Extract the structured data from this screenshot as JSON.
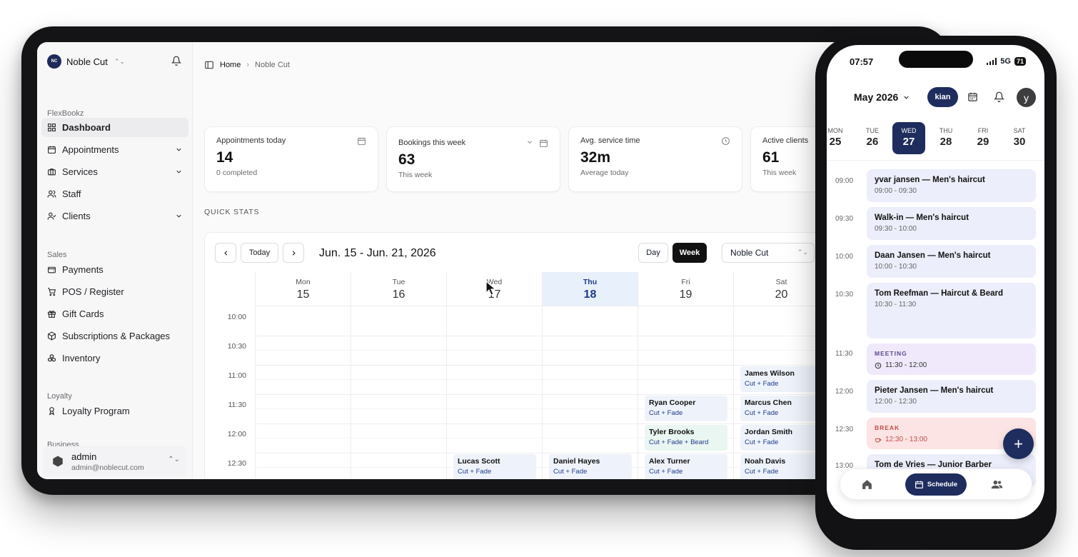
{
  "sidebar": {
    "org_initials": "NC",
    "org_name": "Noble Cut",
    "section_main": "FlexBookz",
    "section_sales": "Sales",
    "section_loyalty": "Loyalty",
    "section_business": "Business",
    "items": [
      {
        "label": "Dashboard",
        "icon": "dashboard-icon"
      },
      {
        "label": "Appointments",
        "icon": "calendar-icon"
      },
      {
        "label": "Services",
        "icon": "briefcase-icon"
      },
      {
        "label": "Staff",
        "icon": "users-icon"
      },
      {
        "label": "Clients",
        "icon": "user-check-icon"
      },
      {
        "label": "Payments",
        "icon": "wallet-icon"
      },
      {
        "label": "POS / Register",
        "icon": "cart-icon"
      },
      {
        "label": "Gift Cards",
        "icon": "gift-icon"
      },
      {
        "label": "Subscriptions & Packages",
        "icon": "package-icon"
      },
      {
        "label": "Inventory",
        "icon": "boxes-icon"
      },
      {
        "label": "Loyalty Program",
        "icon": "award-icon"
      }
    ],
    "user_name": "admin",
    "user_email": "admin@noblecut.com"
  },
  "breadcrumb": {
    "home": "Home",
    "current": "Noble Cut"
  },
  "cards": [
    {
      "label": "Appointments today",
      "value": "14",
      "sub": "0 completed"
    },
    {
      "label": "Bookings this week",
      "value": "63",
      "sub": "This week"
    },
    {
      "label": "Avg. service time",
      "value": "32m",
      "sub": "Average today"
    },
    {
      "label": "Active clients",
      "value": "61",
      "sub": "This week"
    }
  ],
  "quick_stats": "QUICK STATS",
  "calendar": {
    "today_btn": "Today",
    "range": "Jun. 15 - Jun. 21, 2026",
    "view_day": "Day",
    "view_week": "Week",
    "location": "Noble Cut",
    "days": [
      {
        "name": "Mon",
        "num": "15"
      },
      {
        "name": "Tue",
        "num": "16"
      },
      {
        "name": "Wed",
        "num": "17"
      },
      {
        "name": "Thu",
        "num": "18"
      },
      {
        "name": "Fri",
        "num": "19"
      },
      {
        "name": "Sat",
        "num": "20"
      }
    ],
    "times": [
      "10:00",
      "10:30",
      "11:00",
      "11:30",
      "12:00",
      "12:30"
    ],
    "events": [
      {
        "name": "James Wilson",
        "service": "Cut + Fade"
      },
      {
        "name": "Ryan Cooper",
        "service": "Cut + Fade"
      },
      {
        "name": "Marcus Chen",
        "service": "Cut + Fade"
      },
      {
        "name": "Tyler Brooks",
        "service": "Cut + Fade + Beard"
      },
      {
        "name": "Jordan Smith",
        "service": "Cut + Fade"
      },
      {
        "name": "Lucas Scott",
        "service": "Cut + Fade"
      },
      {
        "name": "Daniel Hayes",
        "service": "Cut + Fade"
      },
      {
        "name": "Alex Turner",
        "service": "Cut + Fade"
      },
      {
        "name": "Noah Davis",
        "service": "Cut + Fade"
      }
    ]
  },
  "phone": {
    "time": "07:57",
    "network": "5G",
    "battery": "71",
    "month": "May 2026",
    "staff_chip": "kian",
    "avatar_initial": "y",
    "days": [
      {
        "name": "MON",
        "num": "25"
      },
      {
        "name": "TUE",
        "num": "26"
      },
      {
        "name": "WED",
        "num": "27"
      },
      {
        "name": "THU",
        "num": "28"
      },
      {
        "name": "FRI",
        "num": "29"
      },
      {
        "name": "SAT",
        "num": "30"
      }
    ],
    "times": [
      "09:00",
      "09:30",
      "10:00",
      "10:30",
      "11:30",
      "12:00",
      "12:30",
      "13:00"
    ],
    "events": [
      {
        "title": "yvar jansen — Men's haircut",
        "time": "09:00 - 09:30"
      },
      {
        "title": "Walk-in — Men's haircut",
        "time": "09:30 - 10:00"
      },
      {
        "title": "Daan Jansen — Men's haircut",
        "time": "10:00 - 10:30"
      },
      {
        "title": "Tom Reefman — Haircut & Beard",
        "time": "10:30 - 11:30"
      },
      {
        "tag": "MEETING",
        "time": "11:30 - 12:00"
      },
      {
        "title": "Pieter Jansen — Men's haircut",
        "time": "12:00 - 12:30"
      },
      {
        "tag": "BREAK",
        "time": "12:30 - 13:00"
      },
      {
        "title": "Tom de Vries — Junior Barber"
      }
    ],
    "tab_schedule": "Schedule"
  },
  "colors": {
    "accent": "#1e2d5e",
    "today_col": "#e8f0fc",
    "break": "#fbe4e3",
    "meeting": "#efe9fb"
  }
}
